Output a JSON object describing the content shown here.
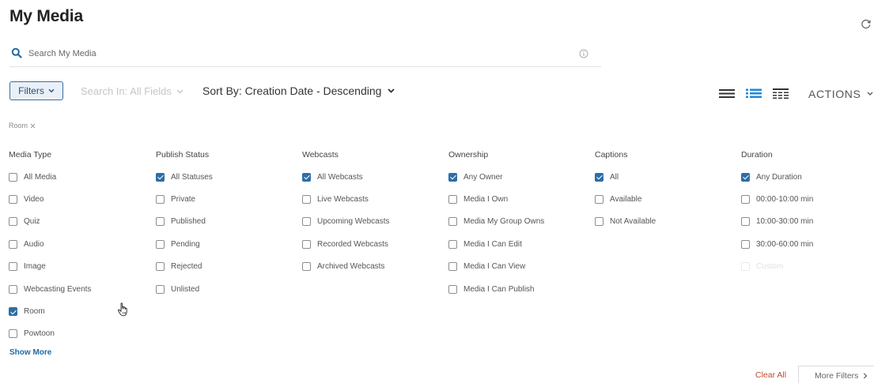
{
  "header": {
    "title": "My Media"
  },
  "search": {
    "placeholder": "Search My Media"
  },
  "toolbar": {
    "filters_label": "Filters",
    "search_in": "Search In: All Fields",
    "sort_by": "Sort By: Creation Date - Descending",
    "actions_label": "ACTIONS"
  },
  "active_filter_chip": {
    "label": "Room"
  },
  "filter_columns": [
    {
      "header": "Media Type",
      "options": [
        {
          "label": "All Media",
          "checked": false
        },
        {
          "label": "Video",
          "checked": false
        },
        {
          "label": "Quiz",
          "checked": false
        },
        {
          "label": "Audio",
          "checked": false
        },
        {
          "label": "Image",
          "checked": false
        },
        {
          "label": "Webcasting Events",
          "checked": false
        },
        {
          "label": "Room",
          "checked": true
        },
        {
          "label": "Powtoon",
          "checked": false
        }
      ]
    },
    {
      "header": "Publish Status",
      "options": [
        {
          "label": "All Statuses",
          "checked": true
        },
        {
          "label": "Private",
          "checked": false
        },
        {
          "label": "Published",
          "checked": false
        },
        {
          "label": "Pending",
          "checked": false
        },
        {
          "label": "Rejected",
          "checked": false
        },
        {
          "label": "Unlisted",
          "checked": false
        }
      ]
    },
    {
      "header": "Webcasts",
      "options": [
        {
          "label": "All Webcasts",
          "checked": true
        },
        {
          "label": "Live Webcasts",
          "checked": false
        },
        {
          "label": "Upcoming Webcasts",
          "checked": false
        },
        {
          "label": "Recorded Webcasts",
          "checked": false
        },
        {
          "label": "Archived Webcasts",
          "checked": false
        }
      ]
    },
    {
      "header": "Ownership",
      "options": [
        {
          "label": "Any Owner",
          "checked": true
        },
        {
          "label": "Media I Own",
          "checked": false
        },
        {
          "label": "Media My Group Owns",
          "checked": false
        },
        {
          "label": "Media I Can Edit",
          "checked": false
        },
        {
          "label": "Media I Can View",
          "checked": false
        },
        {
          "label": "Media I Can Publish",
          "checked": false
        }
      ]
    },
    {
      "header": "Captions",
      "options": [
        {
          "label": "All",
          "checked": true
        },
        {
          "label": "Available",
          "checked": false
        },
        {
          "label": "Not Available",
          "checked": false
        }
      ]
    },
    {
      "header": "Duration",
      "options": [
        {
          "label": "Any Duration",
          "checked": true
        },
        {
          "label": "00:00-10:00 min",
          "checked": false
        },
        {
          "label": "10:00-30:00 min",
          "checked": false
        },
        {
          "label": "30:00-60:00 min",
          "checked": false
        },
        {
          "label": "Custom",
          "checked": false,
          "faded": true
        }
      ]
    }
  ],
  "footer": {
    "show_more": "Show More",
    "clear_all": "Clear All",
    "more_filters": "More Filters"
  },
  "colors": {
    "accent": "#2d6ea6",
    "link": "#1f6aa5",
    "clear": "#c04a2b"
  }
}
